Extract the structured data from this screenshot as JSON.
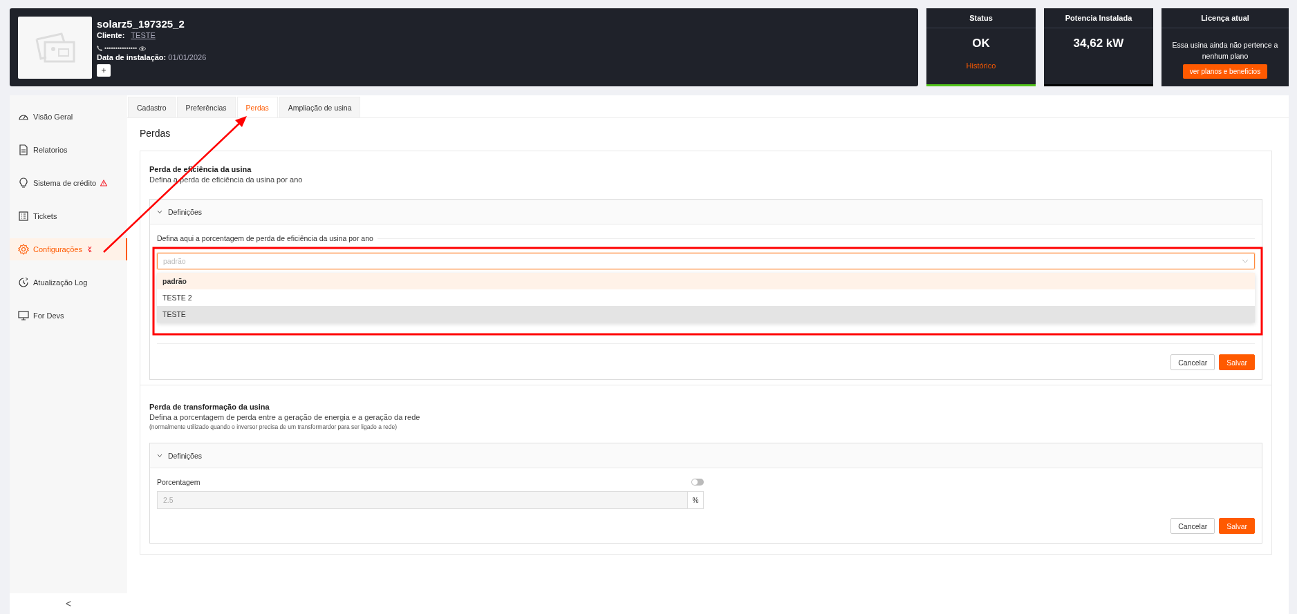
{
  "header": {
    "plant_name": "solarz5_197325_2",
    "client_label": "Cliente:",
    "client": "TESTE",
    "phone": "•••••••••••••••",
    "install_label": "Data de instalação:",
    "install_date": "01/01/2026",
    "add_button": "+"
  },
  "cards": [
    {
      "kind": "status",
      "title": "Status",
      "value": "OK",
      "link": "Histórico"
    },
    {
      "kind": "value",
      "title": "Potencia Instalada",
      "value": "34,62 kW"
    },
    {
      "kind": "license",
      "title": "Licença atual",
      "text": "Essa usina ainda não pertence a nenhum plano",
      "button": "ver planos e beneficios"
    }
  ],
  "sidebar": {
    "items": [
      {
        "label": "Visão Geral",
        "selected": false,
        "alert": false
      },
      {
        "label": "Relatorios",
        "selected": false,
        "alert": false
      },
      {
        "label": "Sistema de crédito",
        "selected": false,
        "alert": true
      },
      {
        "label": "Tickets",
        "selected": false,
        "alert": false
      },
      {
        "label": "Configurações",
        "selected": true,
        "alert": true
      },
      {
        "label": "Atualização Log",
        "selected": false,
        "alert": false
      },
      {
        "label": "For Devs",
        "selected": false,
        "alert": false
      }
    ],
    "collapse": "<"
  },
  "tabs": [
    {
      "label": "Cadastro",
      "selected": false
    },
    {
      "label": "Preferências",
      "selected": false
    },
    {
      "label": "Perdas",
      "selected": true
    },
    {
      "label": "Ampliação de usina",
      "selected": false
    }
  ],
  "page_title": "Perdas",
  "sections": [
    {
      "kind": "select",
      "title": "Perda de eficiência da usina",
      "subtitle": "Defina a perda de eficiência da usina por ano",
      "panel": {
        "header": "Definições",
        "expanded": true,
        "legend": "Defina aqui a porcentagem de perda de eficiência da usina por ano",
        "select": {
          "placeholder": "padrão",
          "open": true,
          "options": [
            {
              "label": "padrão",
              "selected": true,
              "hovered": false
            },
            {
              "label": "TESTE 2",
              "selected": false,
              "hovered": false
            },
            {
              "label": "TESTE",
              "selected": false,
              "hovered": true
            }
          ]
        }
      },
      "buttons": [
        "Cancelar",
        "Salvar"
      ]
    },
    {
      "kind": "percent",
      "title": "Perda de transformação da usina",
      "subtitle": "Defina a porcentagem de perda entre a geração de energia e a geração da rede",
      "note": "(normalmente utilizado quando o inversor precisa de um transformardor para ser ligado a rede)",
      "panel": {
        "header": "Definições",
        "expanded": true,
        "label": "Porcentagem",
        "toggle_on": false,
        "value": "2.5",
        "disabled": true,
        "suffix": "%"
      },
      "buttons": [
        "Cancelar",
        "Salvar"
      ]
    }
  ],
  "annotations": {
    "arrow": true,
    "highlight_frame": true
  }
}
